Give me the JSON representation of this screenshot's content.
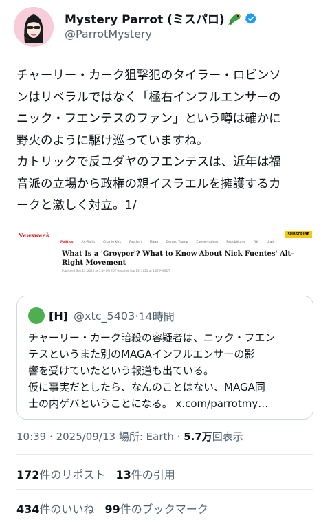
{
  "author": {
    "display_name": "Mystery Parrot (ミスパロ)",
    "handle": "@ParrotMystery",
    "badge_icon": "parrot-emoji",
    "verified_icon": "verified-badge-icon",
    "verified_color": "#1d9bf0"
  },
  "tweet": {
    "lines": [
      "チャーリー・カーク狙撃犯のタイラー・ロビンソ",
      "ンはリベラルではなく「極右インフルエンサーの",
      "ニック・フエンテスのファン」という噂は確かに",
      "野火のように駆け巡っていますね。",
      "カトリックで反ユダヤのフエンテスは、近年は福",
      "音派の立場から政権の親イスラエルを擁護するカ",
      "ークと激しく対立。1/"
    ]
  },
  "article": {
    "logo": "Newsweek",
    "subscribe": "SUBSCRIBE",
    "nav": [
      "Politics",
      "Alt-Right",
      "Charlie Kirk",
      "Fascism",
      "Maga",
      "Donald Trump",
      "Conservatives",
      "Republicans",
      "FBI",
      "Utah"
    ],
    "title": "What Is a 'Groyper'? What to Know About Nick Fuentes' Alt-Right Movement",
    "meta": "Published Sep 13, 2025 at 3:49 PM EDT    Updated Sep 13, 2025 at 8:27 PM EDT"
  },
  "quote": {
    "name": "[H]",
    "handle": "@xtc_5403",
    "time": "14時間",
    "lines": [
      "チャーリー・カーク暗殺の容疑者は、ニック・フエン",
      "テスというまた別のMAGAインフルエンサーの影",
      "響を受けていたという報道も出ている。",
      "仮に事実だとしたら、なんのことはない、MAGA同",
      "士の内ゲバということになる。 x.com/parrotmy…"
    ]
  },
  "meta": {
    "time": "10:39",
    "date": "2025/09/13",
    "location_label": "場所: Earth",
    "views_count": "5.7万",
    "views_label": "回表示"
  },
  "stats": {
    "reposts_count": "172",
    "reposts_label": "件のリポスト",
    "quotes_count": "13",
    "quotes_label": "件の引用",
    "likes_count": "434",
    "likes_label": "件のいいね",
    "bookmarks_count": "99",
    "bookmarks_label": "件のブックマーク"
  }
}
